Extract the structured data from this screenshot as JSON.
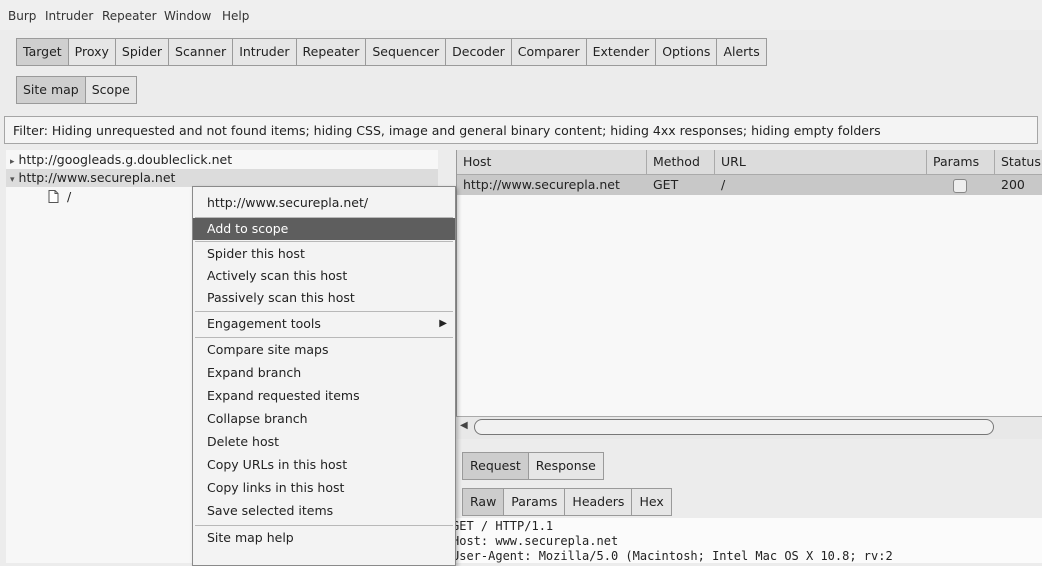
{
  "menubar": [
    "Burp",
    "Intruder",
    "Repeater",
    "Window",
    "Help"
  ],
  "main_tabs": [
    "Target",
    "Proxy",
    "Spider",
    "Scanner",
    "Intruder",
    "Repeater",
    "Sequencer",
    "Decoder",
    "Comparer",
    "Extender",
    "Options",
    "Alerts"
  ],
  "sub_tabs": [
    "Site map",
    "Scope"
  ],
  "filter_text": "Filter: Hiding unrequested and not found items;  hiding CSS, image and general binary content;  hiding 4xx responses;  hiding empty folders",
  "tree": {
    "items": [
      {
        "arrow": "▸",
        "label": "http://googleads.g.doubleclick.net"
      },
      {
        "arrow": "▾",
        "label": "http://www.securepla.net"
      },
      {
        "arrow": "",
        "label": "/"
      }
    ]
  },
  "context_menu": {
    "header": "http://www.securepla.net/",
    "items": [
      "Add to scope",
      "Spider this host",
      "Actively scan this host",
      "Passively scan this host",
      "Engagement tools",
      "Compare site maps",
      "Expand branch",
      "Expand requested items",
      "Collapse branch",
      "Delete host",
      "Copy URLs in this host",
      "Copy links in this host",
      "Save selected items",
      "Site map help"
    ],
    "submenu_arrow": "▶",
    "highlighted": "Add to scope"
  },
  "table": {
    "columns": [
      "Host",
      "Method",
      "URL",
      "Params",
      "Status"
    ],
    "rows": [
      {
        "host": "http://www.securepla.net",
        "method": "GET",
        "url": "/",
        "params": false,
        "status": "200"
      }
    ]
  },
  "message_tabs": [
    "Request",
    "Response"
  ],
  "view_tabs": [
    "Raw",
    "Params",
    "Headers",
    "Hex"
  ],
  "raw_lines": [
    "GET / HTTP/1.1",
    "Host: www.securepla.net",
    "User-Agent: Mozilla/5.0 (Macintosh; Intel Mac OS X 10.8; rv:2"
  ]
}
